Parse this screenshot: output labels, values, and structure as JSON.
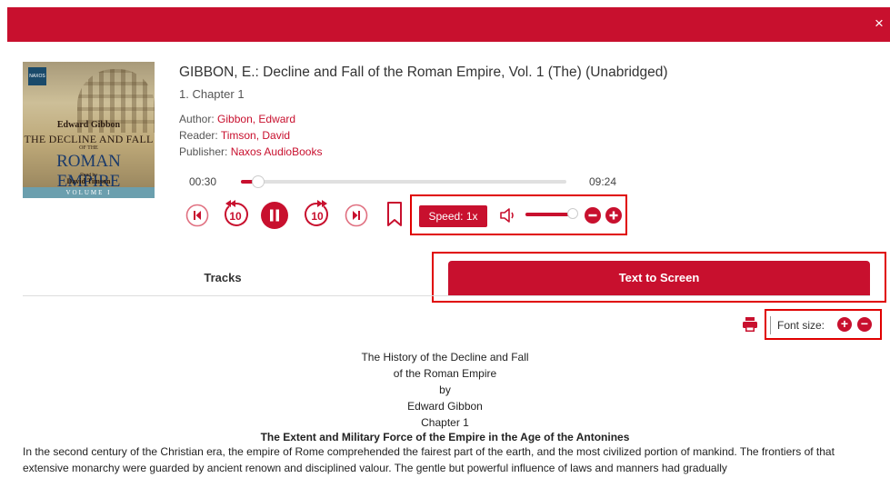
{
  "header": {
    "close_glyph": "×",
    "accent_color": "#c8102e"
  },
  "cover": {
    "logo": "NAXOS",
    "author": "Edward Gibbon",
    "title_line1": "THE DECLINE AND FALL",
    "title_line2": "OF THE",
    "title_line3": "ROMAN EMPIRE",
    "read_by": "Read by",
    "reader": "David Timson",
    "volume": "VOLUME I"
  },
  "book": {
    "title": "GIBBON, E.: Decline and Fall of the Roman Empire, Vol. 1 (The) (Unabridged)",
    "chapter": "1. Chapter 1",
    "author_label": "Author:",
    "author": "Gibbon, Edward",
    "reader_label": "Reader:",
    "reader": "Timson, David",
    "publisher_label": "Publisher:",
    "publisher": "Naxos AudioBooks"
  },
  "player": {
    "current_time": "00:30",
    "total_time": "09:24",
    "progress_fraction": 0.053,
    "speed_label": "Speed: 1x",
    "volume_fraction": 0.93,
    "skip_back_seconds": "10",
    "skip_forward_seconds": "10"
  },
  "tabs": [
    {
      "label": "Tracks",
      "active": false
    },
    {
      "label": "Text to Screen",
      "active": true
    }
  ],
  "text_panel": {
    "font_size_label": "Font size:",
    "increase_glyph": "+",
    "decrease_glyph": "−",
    "heading_lines": [
      "The History of the Decline and Fall",
      "of the Roman Empire",
      "by",
      "Edward Gibbon",
      "Chapter 1"
    ],
    "subheading": "The Extent and Military Force of the Empire in the Age of the Antonines",
    "paragraph": "In the second century of the Christian era, the empire of Rome comprehended the fairest part of the earth, and the most civilized portion of mankind. The frontiers of that extensive monarchy were guarded by ancient renown and disciplined valour. The gentle but powerful influence of laws and manners had gradually"
  }
}
